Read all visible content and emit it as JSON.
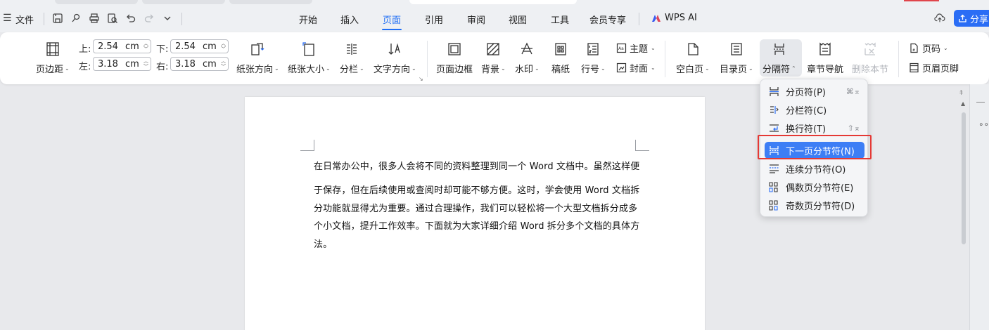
{
  "header": {
    "menu_icon": "☰",
    "file_label": "文件",
    "tabs": [
      "开始",
      "插入",
      "页面",
      "引用",
      "审阅",
      "视图",
      "工具",
      "会员专享"
    ],
    "active_tab": "页面",
    "ai_label": "WPS AI",
    "share_label": "分享",
    "accent_color": "#1f6ef5"
  },
  "ribbon": {
    "margins_label": "页边距",
    "top_label": "上:",
    "top_value": "2.54",
    "bottom_label": "下:",
    "bottom_value": "2.54",
    "left_label": "左:",
    "left_value": "3.18",
    "right_label": "右:",
    "right_value": "3.18",
    "unit": "cm",
    "orientation_label": "纸张方向",
    "size_label": "纸张大小",
    "columns_label": "分栏",
    "text_direction_label": "文字方向",
    "page_border_label": "页面边框",
    "background_label": "背景",
    "watermark_label": "水印",
    "manuscript_label": "稿纸",
    "line_number_label": "行号",
    "theme_label": "主题",
    "cover_label": "封面",
    "blank_page_label": "空白页",
    "toc_page_label": "目录页",
    "break_label": "分隔符",
    "chapter_nav_label": "章节导航",
    "delete_section_label": "删除本节",
    "page_number_label": "页码",
    "header_footer_label": "页眉页脚"
  },
  "dropdown": {
    "items": [
      {
        "label": "分页符(P)",
        "shortcut": "⌘⌅"
      },
      {
        "label": "分栏符(C)",
        "shortcut": ""
      },
      {
        "label": "换行符(T)",
        "shortcut": "⇧⌅"
      },
      {
        "label": "下一页分节符(N)",
        "shortcut": ""
      },
      {
        "label": "连续分节符(O)",
        "shortcut": ""
      },
      {
        "label": "偶数页分节符(E)",
        "shortcut": ""
      },
      {
        "label": "奇数页分节符(D)",
        "shortcut": ""
      }
    ],
    "highlighted_index": 3,
    "highlight_color": "#3d7ef5",
    "annotation_color": "#e53935"
  },
  "document": {
    "lines": [
      "在日常办公中，很多人会将不同的资料整理到同一个 Word 文档中。虽然这样便",
      "于保存，但在后续使用或查阅时却可能不够方便。这时，学会使用 Word 文档拆",
      "分功能就显得尤为重要。通过合理操作，我们可以轻松将一个大型文档拆分成多",
      "个小文档，提升工作效率。下面就为大家详细介绍 Word 拆分多个文档的具体方",
      "法。"
    ]
  }
}
